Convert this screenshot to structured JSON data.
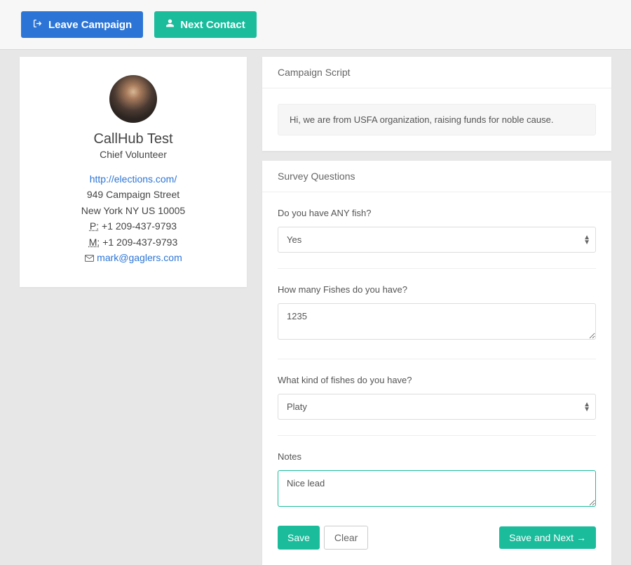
{
  "header": {
    "leave_label": "Leave Campaign",
    "next_label": "Next Contact"
  },
  "contact": {
    "name": "CallHub Test",
    "role": "Chief Volunteer",
    "website": "http://elections.com/",
    "address_line1": "949 Campaign Street",
    "address_line2": "New York NY US 10005",
    "phone_label": "P:",
    "phone": " +1 209-437-9793",
    "mobile_label": "M:",
    "mobile": " +1 209-437-9793",
    "email": "mark@gaglers.com"
  },
  "script_panel": {
    "title": "Campaign Script",
    "body": "Hi, we are from USFA organization, raising funds for noble cause."
  },
  "survey": {
    "title": "Survey Questions",
    "q1_label": "Do you have ANY fish?",
    "q1_value": "Yes",
    "q2_label": "How many Fishes do you have?",
    "q2_value": "1235",
    "q3_label": "What kind of fishes do you have?",
    "q3_value": "Platy",
    "notes_label": "Notes",
    "notes_value": "Nice lead"
  },
  "footer": {
    "save_label": "Save",
    "clear_label": "Clear",
    "save_next_label": "Save and Next "
  }
}
